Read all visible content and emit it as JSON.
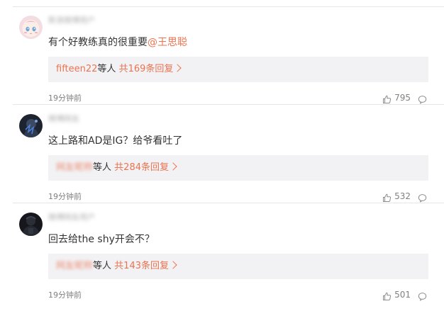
{
  "comments": [
    {
      "username": "新浪微博用户",
      "text": "有个好教练真的很重要",
      "mention": "@王思聪",
      "reply_users": "fifteen22",
      "reply_mid": "等人",
      "reply_count": "共169条回复",
      "time": "19分钟前",
      "likes": "795"
    },
    {
      "username": "微博网友",
      "text": "这上路和AD是IG？给爷看吐了",
      "mention": "",
      "reply_users": "网友昵称",
      "reply_mid": "等人",
      "reply_count": "共284条回复",
      "time": "19分钟前",
      "likes": "532"
    },
    {
      "username": "微博网友用户",
      "text": "回去给the shy开会不？",
      "mention": "",
      "reply_users": "网友昵称",
      "reply_mid": "等人",
      "reply_count": "共143条回复",
      "time": "19分钟前",
      "likes": "501"
    }
  ],
  "colors": {
    "accent": "#eb7350",
    "reply_bg": "#f2f2f5",
    "text": "#333333",
    "muted": "#808080"
  },
  "icons": {
    "like": "thumbs-up-icon",
    "comment": "comment-bubble-icon",
    "chevron": "chevron-right-icon"
  }
}
